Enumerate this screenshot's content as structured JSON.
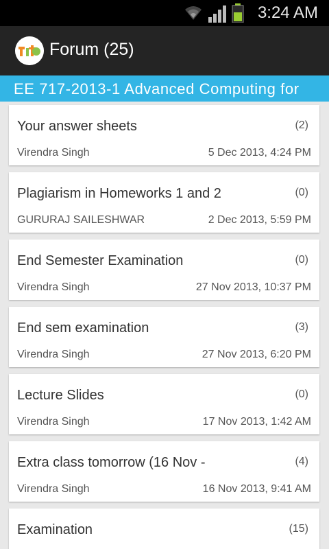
{
  "status_bar": {
    "time": "3:24 AM",
    "wifi_icon": "wifi-icon",
    "signal_icon": "signal-icon",
    "battery_icon": "battery-icon"
  },
  "action_bar": {
    "title": "Forum (25)",
    "logo_icon": "app-logo-icon"
  },
  "course_header": {
    "text": "EE 717-2013-1 Advanced Computing for"
  },
  "colors": {
    "accent": "#33b5e5",
    "action_bar": "#242424",
    "background": "#e8e8e8"
  },
  "topics": [
    {
      "title": "Your answer sheets",
      "count": "(2)",
      "author": "Virendra Singh",
      "date": "5 Dec 2013, 4:24 PM"
    },
    {
      "title": "Plagiarism in Homeworks 1 and 2",
      "count": "(0)",
      "author": "GURURAJ SAILESHWAR",
      "date": "2 Dec 2013, 5:59 PM"
    },
    {
      "title": "End Semester Examination",
      "count": "(0)",
      "author": "Virendra Singh",
      "date": "27 Nov 2013, 10:37 PM"
    },
    {
      "title": "End sem examination",
      "count": "(3)",
      "author": "Virendra Singh",
      "date": "27 Nov 2013, 6:20 PM"
    },
    {
      "title": "Lecture Slides",
      "count": "(0)",
      "author": "Virendra Singh",
      "date": "17 Nov 2013, 1:42 AM"
    },
    {
      "title": "Extra class tomorrow (16 Nov -",
      "count": "(4)",
      "author": "Virendra Singh",
      "date": "16 Nov 2013, 9:41 AM"
    },
    {
      "title": "Examination",
      "count": "(15)",
      "author": "",
      "date": ""
    }
  ]
}
